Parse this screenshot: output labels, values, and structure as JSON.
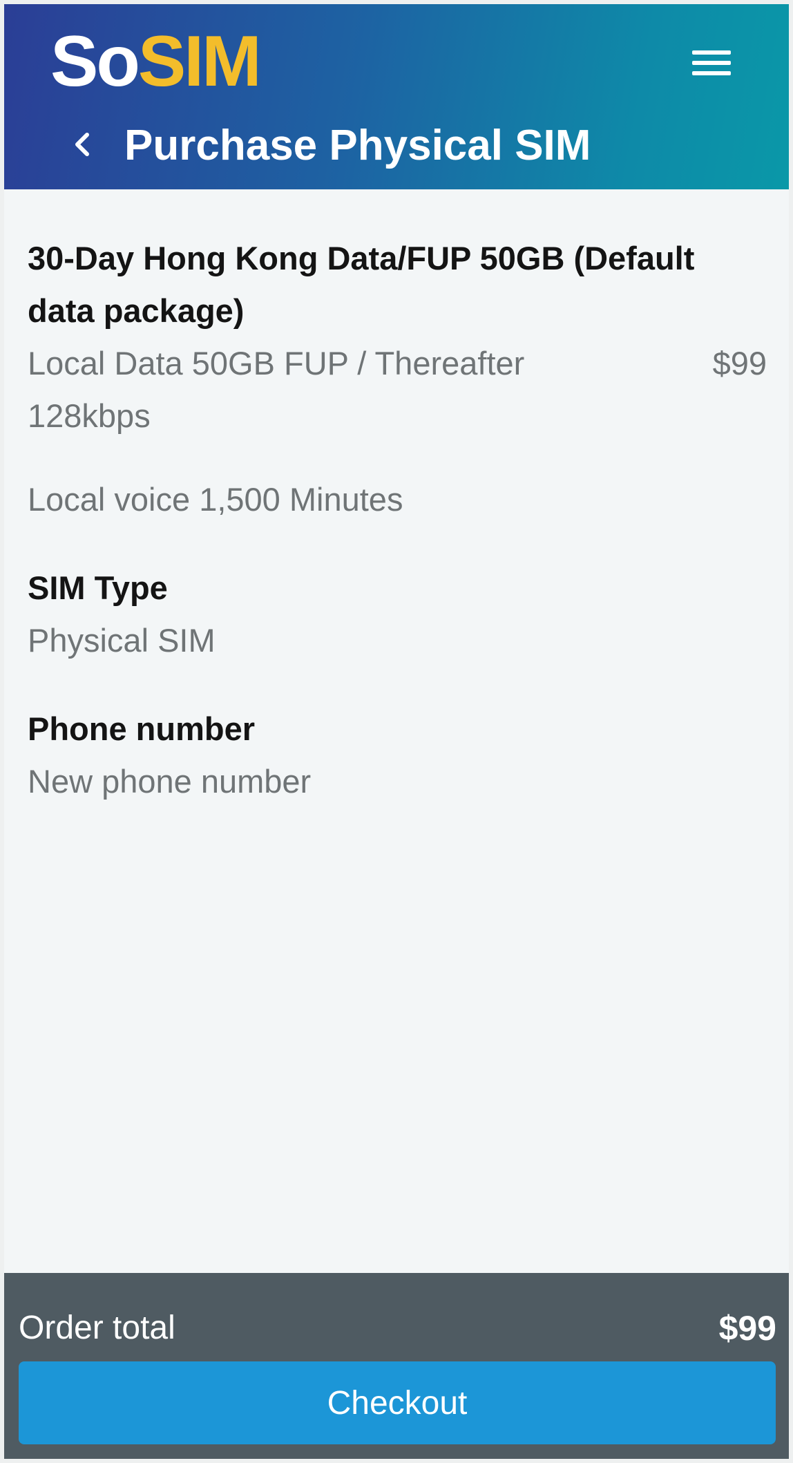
{
  "brand": {
    "logo_part1": "So",
    "logo_part2": "SIM"
  },
  "header": {
    "title": "Purchase Physical SIM",
    "back_icon": "chevron-left-icon",
    "menu_icon": "hamburger-menu-icon"
  },
  "plan": {
    "title": "30-Day Hong Kong Data/FUP 50GB (Default data package)",
    "data_desc": "Local Data 50GB FUP / Thereafter 128kbps",
    "price": "$99",
    "voice_desc": "Local voice 1,500 Minutes"
  },
  "sim_type": {
    "label": "SIM Type",
    "value": "Physical SIM"
  },
  "phone_number": {
    "label": "Phone number",
    "value": "New phone number"
  },
  "footer": {
    "order_total_label": "Order total",
    "order_total_value": "$99",
    "checkout_label": "Checkout"
  },
  "colors": {
    "header_start": "#2b3e96",
    "header_end": "#0a98a8",
    "logo_accent": "#f3bd2b",
    "footer_bg": "#4f5b62",
    "checkout_bg": "#1c96d7"
  }
}
